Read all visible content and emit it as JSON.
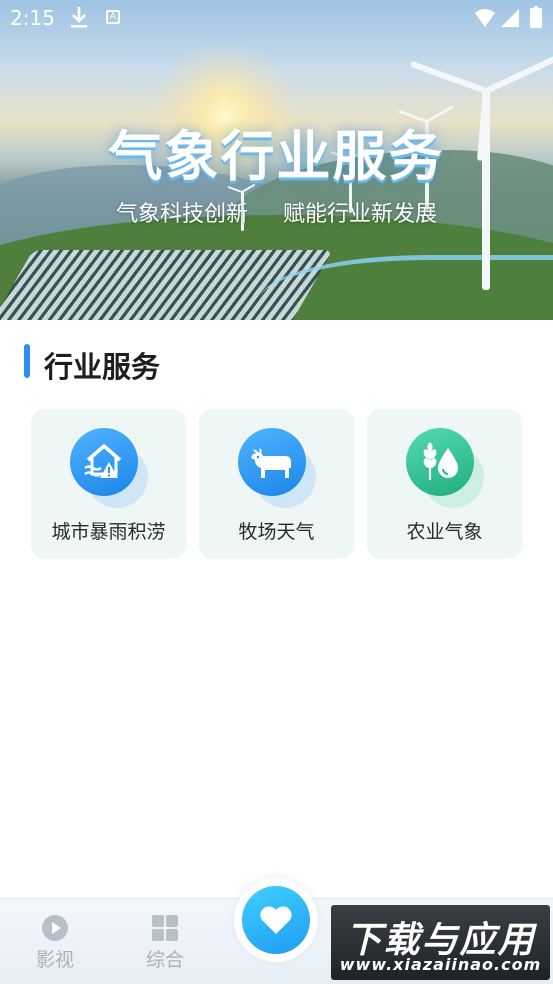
{
  "status_bar": {
    "time": "2:15",
    "icons": [
      "download-icon",
      "a-notification-icon",
      "wifi-icon",
      "signal-icon",
      "battery-icon"
    ]
  },
  "hero": {
    "title": "气象行业服务",
    "subtitle": "气象科技创新     赋能行业新发展"
  },
  "section": {
    "title": "行业服务",
    "accent_color": "#2f8df0"
  },
  "services": [
    {
      "label": "城市暴雨积涝",
      "icon": "flooded-house-warning-icon",
      "color": "#2a92ee"
    },
    {
      "label": "牧场天气",
      "icon": "cow-icon",
      "color": "#2a92ee"
    },
    {
      "label": "农业气象",
      "icon": "wheat-droplet-icon",
      "color": "#25b98a"
    }
  ],
  "bottom_nav": {
    "items": [
      {
        "label": "影视",
        "icon": "play-circle-icon"
      },
      {
        "label": "综合",
        "icon": "grid-icon"
      }
    ],
    "center_icon": "heart-icon",
    "center_color": "#2aaef5"
  },
  "watermark": {
    "main": "下载与应用",
    "url": "www.xiazaiinao.com"
  }
}
